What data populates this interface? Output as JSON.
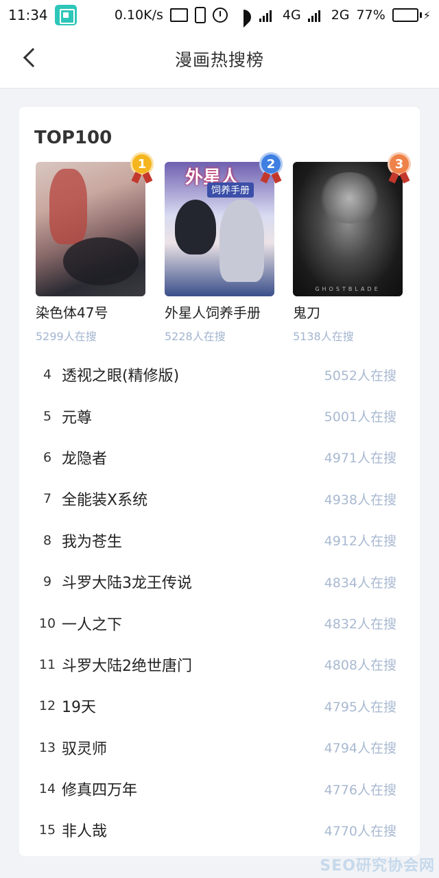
{
  "status_bar": {
    "time": "11:34",
    "net_speed": "0.10K/s",
    "signal_1": "4G",
    "signal_2": "2G",
    "battery_percent": "77%",
    "battery_level": 0.77,
    "battery_color": "#21c03a"
  },
  "nav": {
    "title": "漫画热搜榜",
    "back_icon": "chevron-left-icon"
  },
  "card": {
    "title": "TOP100"
  },
  "top3": [
    {
      "rank": "1",
      "name": "染色体47号",
      "count": "5299人在搜",
      "badge_color": "#f5b51e"
    },
    {
      "rank": "2",
      "name": "外星人饲养手册",
      "count": "5228人在搜",
      "badge_color": "#3f7fe2",
      "cover_title": "外星人",
      "cover_subtitle": "饲养手册"
    },
    {
      "rank": "3",
      "name": "鬼刀",
      "count": "5138人在搜",
      "badge_color": "#ef8249",
      "cover_title": "GHOSTBLADE"
    }
  ],
  "ranking": [
    {
      "rank": "4",
      "name": "透视之眼(精修版)",
      "count": "5052人在搜"
    },
    {
      "rank": "5",
      "name": "元尊",
      "count": "5001人在搜"
    },
    {
      "rank": "6",
      "name": "龙隐者",
      "count": "4971人在搜"
    },
    {
      "rank": "7",
      "name": "全能装X系统",
      "count": "4938人在搜"
    },
    {
      "rank": "8",
      "name": "我为苍生",
      "count": "4912人在搜"
    },
    {
      "rank": "9",
      "name": "斗罗大陆3龙王传说",
      "count": "4834人在搜"
    },
    {
      "rank": "10",
      "name": "一人之下",
      "count": "4832人在搜"
    },
    {
      "rank": "11",
      "name": "斗罗大陆2绝世唐门",
      "count": "4808人在搜"
    },
    {
      "rank": "12",
      "name": "19天",
      "count": "4795人在搜"
    },
    {
      "rank": "13",
      "name": "驭灵师",
      "count": "4794人在搜"
    },
    {
      "rank": "14",
      "name": "修真四万年",
      "count": "4776人在搜"
    },
    {
      "rank": "15",
      "name": "非人哉",
      "count": "4770人在搜"
    }
  ],
  "colors": {
    "count_text": "#a9b9d1",
    "screenshot_icon": "#2ec6b8"
  },
  "watermark": "SEO研究协会网"
}
